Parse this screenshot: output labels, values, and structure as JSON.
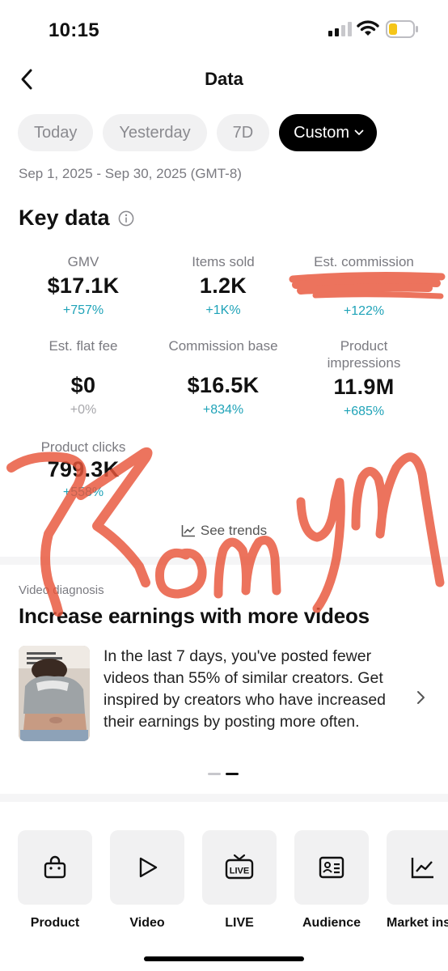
{
  "status_bar": {
    "time": "10:15"
  },
  "header": {
    "title": "Data"
  },
  "tabs": [
    {
      "label": "Today",
      "active": false
    },
    {
      "label": "Yesterday",
      "active": false
    },
    {
      "label": "7D",
      "active": false
    },
    {
      "label": "Custom",
      "active": true
    }
  ],
  "date_range": "Sep 1, 2025 - Sep 30, 2025 (GMT-8)",
  "key_data": {
    "title": "Key data",
    "metrics": [
      {
        "label": "GMV",
        "value": "$17.1K",
        "change": "+757%"
      },
      {
        "label": "Items sold",
        "value": "1.2K",
        "change": "+1K%"
      },
      {
        "label": "Est. commission",
        "value": "",
        "change": "+122%"
      },
      {
        "label": "Est. flat fee",
        "value": "$0",
        "change": "+0%"
      },
      {
        "label": "Commission base",
        "value": "$16.5K",
        "change": "+834%"
      },
      {
        "label": "Product impressions",
        "value": "11.9M",
        "change": "+685%"
      },
      {
        "label": "Product clicks",
        "value": "799.3K",
        "change": "+558%"
      }
    ],
    "see_trends": "See trends"
  },
  "video_diagnosis": {
    "label": "Video diagnosis",
    "title": "Increase earnings with more videos",
    "body": "In the last 7 days, you've posted fewer videos than 55% of similar creators. Get inspired by creators who have increased their earnings by posting more often."
  },
  "tools": [
    {
      "label": "Product",
      "icon": "shopping-bag-icon"
    },
    {
      "label": "Video",
      "icon": "play-icon"
    },
    {
      "label": "LIVE",
      "icon": "live-tv-icon"
    },
    {
      "label": "Audience",
      "icon": "id-card-icon"
    },
    {
      "label": "Market ins",
      "icon": "line-chart-icon"
    }
  ],
  "colors": {
    "accent_positive": "#1fa3b8",
    "tab_active_bg": "#000000",
    "tab_bg": "#f1f1f2",
    "scribble": "#e8553a"
  }
}
